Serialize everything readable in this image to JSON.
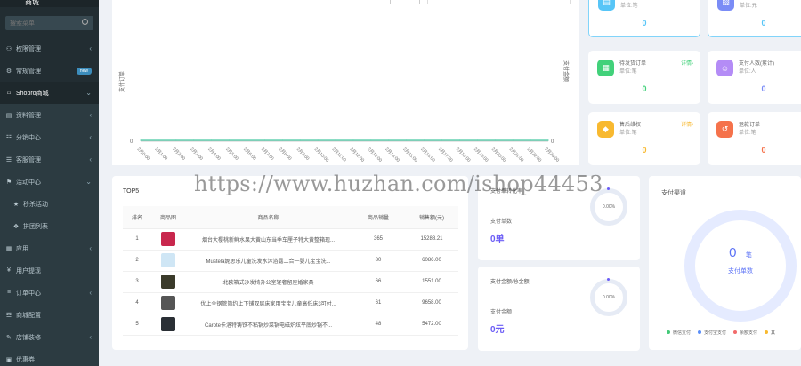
{
  "sidebar": {
    "brand": "商城",
    "search_placeholder": "搜索菜单",
    "items": [
      {
        "label": "权限管理",
        "icon": "users-icon",
        "chevron": "‹"
      },
      {
        "label": "常规管理",
        "icon": "cogs-icon",
        "badge": "new"
      },
      {
        "label": "Shopro商城",
        "icon": "home-icon",
        "chevron": "⌄",
        "open": true
      },
      {
        "label": "资料管理",
        "icon": "file-icon",
        "chevron": "‹",
        "sub": true
      },
      {
        "label": "分销中心",
        "icon": "sitemap-icon",
        "chevron": "‹",
        "sub": true
      },
      {
        "label": "客服管理",
        "icon": "headset-icon",
        "chevron": "‹",
        "sub": true
      },
      {
        "label": "活动中心",
        "icon": "flag-icon",
        "chevron": "⌄",
        "sub": true
      },
      {
        "label": "秒杀活动",
        "icon": "star-icon",
        "sub": true
      },
      {
        "label": "拼团列表",
        "icon": "group-icon",
        "sub": true
      },
      {
        "label": "应用",
        "icon": "grid-icon",
        "chevron": "‹",
        "sub": true
      },
      {
        "label": "用户提现",
        "icon": "yen-icon",
        "sub": true
      },
      {
        "label": "订单中心",
        "icon": "list-icon",
        "chevron": "‹",
        "sub": true
      },
      {
        "label": "商城配置",
        "icon": "sliders-icon",
        "sub": true
      },
      {
        "label": "店铺装修",
        "icon": "brush-icon",
        "chevron": "‹",
        "sub": true
      },
      {
        "label": "优惠券",
        "icon": "ticket-icon",
        "sub": true
      }
    ]
  },
  "chart": {
    "y_left_label": "支付订单",
    "y_right_label": "支付金额",
    "y_left_tick": "0",
    "y_right_tick": "0"
  },
  "chart_data": {
    "type": "line",
    "x": [
      "2月0:00",
      "2月1:00",
      "2月2:00",
      "2月3:00",
      "2月4:00",
      "2月5:00",
      "2月6:00",
      "2月7:00",
      "2月8:00",
      "2月9:00",
      "2月10:00",
      "2月11:00",
      "2月12:00",
      "2月13:00",
      "2月14:00",
      "2月15:00",
      "2月16:00",
      "2月17:00",
      "2月18:00",
      "2月19:00",
      "2月20:00",
      "2月21:00",
      "2月22:00",
      "2月23:00"
    ],
    "series": [
      {
        "name": "支付订单",
        "values": [
          0,
          0,
          0,
          0,
          0,
          0,
          0,
          0,
          0,
          0,
          0,
          0,
          0,
          0,
          0,
          0,
          0,
          0,
          0,
          0,
          0,
          0,
          0,
          0
        ]
      },
      {
        "name": "支付金额",
        "values": [
          0,
          0,
          0,
          0,
          0,
          0,
          0,
          0,
          0,
          0,
          0,
          0,
          0,
          0,
          0,
          0,
          0,
          0,
          0,
          0,
          0,
          0,
          0,
          0
        ]
      }
    ],
    "xlabel": "",
    "ylabel": "支付订单",
    "y2label": "支付金额",
    "ylim": [
      0,
      0
    ],
    "grid": false
  },
  "stats": [
    {
      "title": "支付订单",
      "sub": "单位:笔",
      "link": "详情›",
      "value": "0",
      "color": "#57c5f7",
      "icon": "file-icon",
      "selected": true
    },
    {
      "title": "支付金额",
      "sub": "单位:元",
      "link": "",
      "value": "0",
      "color": "#7a8cf6",
      "icon": "wallet-icon",
      "selected": true
    },
    {
      "title": "待发货订单",
      "sub": "单位:笔",
      "link": "详情›",
      "value": "0",
      "color": "#42d17a",
      "icon": "calendar-icon",
      "selected": false
    },
    {
      "title": "支付人数(累计)",
      "sub": "单位:人",
      "link": "",
      "value": "0",
      "color": "#b48cf6",
      "icon": "user-icon",
      "selected": false
    },
    {
      "title": "售后维权",
      "sub": "单位:笔",
      "link": "详情›",
      "value": "0",
      "color": "#f8b930",
      "icon": "shield-icon",
      "selected": false
    },
    {
      "title": "退款订单",
      "sub": "单位:笔",
      "link": "",
      "value": "0",
      "color": "#f5724b",
      "icon": "refund-icon",
      "selected": false
    }
  ],
  "top5": {
    "title": "TOP5",
    "headers": [
      "排名",
      "商品图",
      "商品名称",
      "商品销量",
      "销售额(元)"
    ],
    "rows": [
      {
        "rank": "1",
        "name": "烟台大樱桃新鲜水果大黄山东当季车厘子特大黄整箱现...",
        "sales": "365",
        "amount": "15288.21",
        "img": "#c8274d"
      },
      {
        "rank": "2",
        "name": "Mustela妮思乐儿童洗发水沐浴露二合一婴儿宝宝洗...",
        "sales": "80",
        "amount": "6086.00",
        "img": "#cfe6f5"
      },
      {
        "rank": "3",
        "name": "北欧箱式沙发椅办公室轻奢留座婚家具",
        "sales": "66",
        "amount": "1551.00",
        "img": "#3a3a2a"
      },
      {
        "rank": "4",
        "name": "优上全钢管简约上下铺双层床家用宝宝儿童高低床3可付...",
        "sales": "61",
        "amount": "9658.00",
        "img": "#555555"
      },
      {
        "rank": "5",
        "name": "Carote卡洛特铸铁不粘锅炒菜锅电磁炉炫平底炒锅不...",
        "sales": "48",
        "amount": "5472.00",
        "img": "#2a2f35"
      }
    ]
  },
  "rings": [
    {
      "title": "支付单转化率",
      "label": "支付单数",
      "value": "0单",
      "pct": "0.00%"
    },
    {
      "title": "支付金额/总金额",
      "label": "支付金额",
      "value": "0元",
      "pct": "0.00%"
    }
  ],
  "pay_channel": {
    "title": "支付渠道",
    "center_value": "0",
    "center_unit": "笔",
    "center_label": "支付单数",
    "legend": [
      {
        "name": "微信支付",
        "color": "#42c977"
      },
      {
        "name": "支付宝支付",
        "color": "#5b8ff9"
      },
      {
        "name": "余额支付",
        "color": "#f26b6b"
      },
      {
        "name": "其",
        "color": "#f8b930"
      }
    ]
  },
  "watermark": "https://www.huzhan.com/ishop44453"
}
